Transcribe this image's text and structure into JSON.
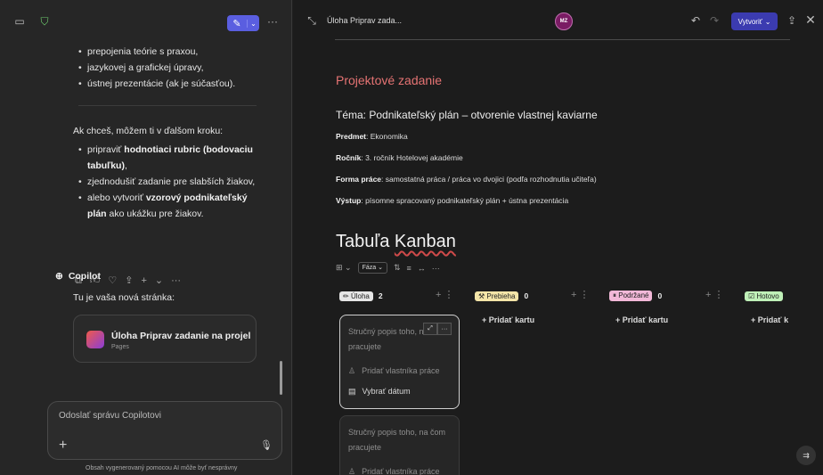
{
  "left": {
    "bullets_top": [
      "prepojenia teórie s praxou,",
      "jazykovej a grafickej úpravy,",
      "ústnej prezentácie (ak je súčasťou)."
    ],
    "intro": "Ak chceš, môžem ti v ďalšom kroku:",
    "b1_pre": "pripraviť ",
    "b1_bold": "hodnotiaci rubric (bodovaciu tabuľku)",
    "b1_post": ",",
    "b2": "zjednodušiť zadanie pre slabších žiakov,",
    "b3_pre": "alebo vytvoriť ",
    "b3_bold": "vzorový podnikateľský plán",
    "b3_post": " ako ukážku pre žiakov.",
    "copilot": "Copilot",
    "new_page": "Tu je vaša nová stránka:",
    "card_title": "Úloha Priprav zadanie na projel",
    "card_sub": "Pages",
    "input_placeholder": "Odoslať správu Copilotovi",
    "disclaimer": "Obsah vygenerovaný pomocou AI môže byť nesprávny"
  },
  "right": {
    "title": "Úloha Priprav zada...",
    "avatar": "MZ",
    "create_button": "Vytvoriť",
    "heading": "Projektové zadanie",
    "tema": "Téma: Podnikateľský plán – otvorenie vlastnej kaviarne",
    "predmet_label": "Predmet",
    "predmet_value": ": Ekonomika",
    "rocnik_label": "Ročník",
    "rocnik_value": ": 3. ročník Hotelovej akadémie",
    "forma_label": "Forma práce",
    "forma_value": ": samostatná práca / práca vo dvojici (podľa rozhodnutia učiteľa)",
    "vystup_label": "Výstup",
    "vystup_value": ": písomne spracovaný podnikateľský plán + ústna prezentácia",
    "kanban_title_pre": "Tabuľa ",
    "kanban_title_word": "Kanban",
    "filter": "Fáza",
    "columns": [
      {
        "label": "Úloha",
        "count": "2",
        "emoji": "✏️",
        "color": "#e6e6e6",
        "text": "#222"
      },
      {
        "label": "Prebieha",
        "count": "0",
        "emoji": "🛠",
        "color": "#f4e5a8",
        "text": "#222"
      },
      {
        "label": "Podržané",
        "count": "0",
        "emoji": "⏸",
        "color": "#f2b8d8",
        "text": "#222"
      },
      {
        "label": "Hotovo",
        "count": "",
        "emoji": "✅",
        "color": "#bff0b8",
        "text": "#222"
      }
    ],
    "add_card": "Pridať kartu",
    "add_card_cut": "Pridať k",
    "card_text": "Stručný popis toho, na čom pracujete",
    "add_owner": "Pridať vlastníka práce",
    "pick_date": "Vybrať dátum"
  }
}
